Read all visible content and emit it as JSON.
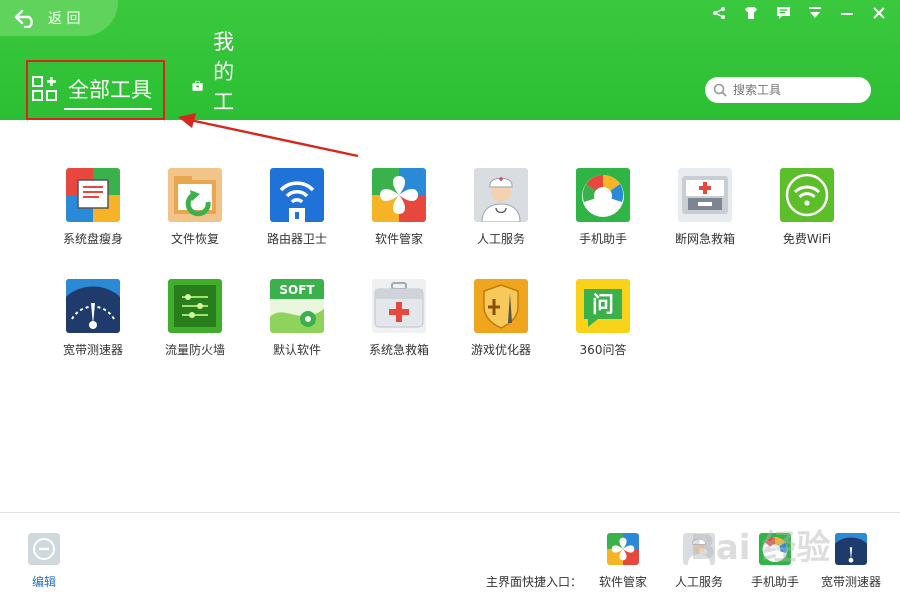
{
  "header": {
    "back_label": "返 回",
    "tab_all_label": "全部工具",
    "tab_mine_label": "我的工具",
    "search_placeholder": "搜索工具",
    "window_icons": [
      "share-icon",
      "skin-icon",
      "message-icon",
      "menu-icon",
      "minimize-icon",
      "close-icon"
    ]
  },
  "tools": [
    {
      "label": "系统盘瘦身",
      "icon": "disk-slim-icon"
    },
    {
      "label": "文件恢复",
      "icon": "file-recovery-icon"
    },
    {
      "label": "路由器卫士",
      "icon": "router-guard-icon"
    },
    {
      "label": "软件管家",
      "icon": "software-manager-icon"
    },
    {
      "label": "人工服务",
      "icon": "human-service-icon"
    },
    {
      "label": "手机助手",
      "icon": "phone-assistant-icon"
    },
    {
      "label": "断网急救箱",
      "icon": "network-firstaid-icon"
    },
    {
      "label": "免费WiFi",
      "icon": "free-wifi-icon"
    },
    {
      "label": "宽带测速器",
      "icon": "speedtest-icon"
    },
    {
      "label": "流量防火墙",
      "icon": "traffic-firewall-icon"
    },
    {
      "label": "默认软件",
      "icon": "default-software-icon"
    },
    {
      "label": "系统急救箱",
      "icon": "system-firstaid-icon"
    },
    {
      "label": "游戏优化器",
      "icon": "game-optimizer-icon"
    },
    {
      "label": "360问答",
      "icon": "qa-icon"
    }
  ],
  "footer": {
    "edit_label": "编辑",
    "shortcut_label": "主界面快捷入口：",
    "shortcuts": [
      {
        "label": "软件管家",
        "icon": "software-manager-icon"
      },
      {
        "label": "人工服务",
        "icon": "human-service-icon"
      },
      {
        "label": "手机助手",
        "icon": "phone-assistant-icon"
      },
      {
        "label": "宽带测速器",
        "icon": "speedtest-icon"
      }
    ],
    "watermark": "Bai 经验"
  },
  "colors": {
    "header_green": "#2cbf33",
    "highlight_red": "#d6261e",
    "link_blue": "#1a73c8"
  }
}
